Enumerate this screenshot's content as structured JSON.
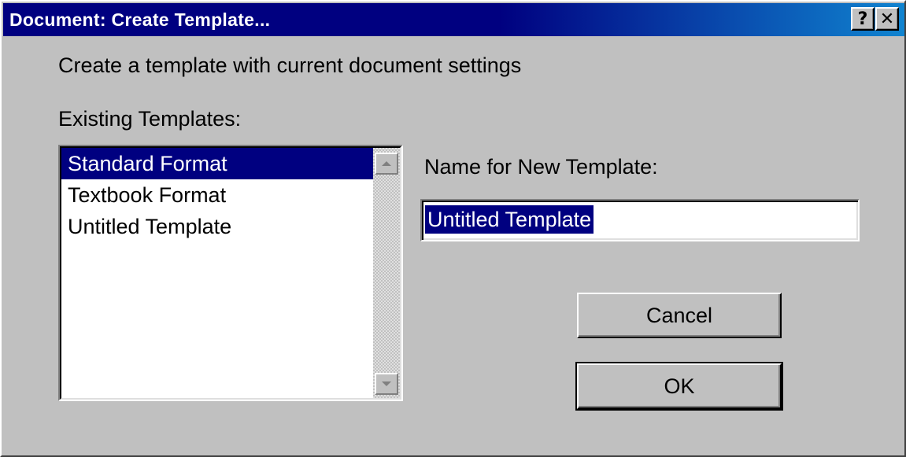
{
  "window": {
    "title": "Document: Create Template...",
    "help_glyph": "?",
    "close_glyph": "✕"
  },
  "description": "Create a template with current document settings",
  "existing_templates": {
    "label": "Existing Templates:",
    "items": [
      {
        "label": "Standard Format",
        "selected": true
      },
      {
        "label": "Textbook Format",
        "selected": false
      },
      {
        "label": "Untitled Template",
        "selected": false
      }
    ]
  },
  "new_template": {
    "label": "Name for New Template:",
    "value": "Untitled Template"
  },
  "buttons": {
    "cancel_label": "Cancel",
    "ok_label": "OK"
  },
  "colors": {
    "titlebar": "#000080",
    "selection": "#000080",
    "face": "#c0c0c0"
  }
}
